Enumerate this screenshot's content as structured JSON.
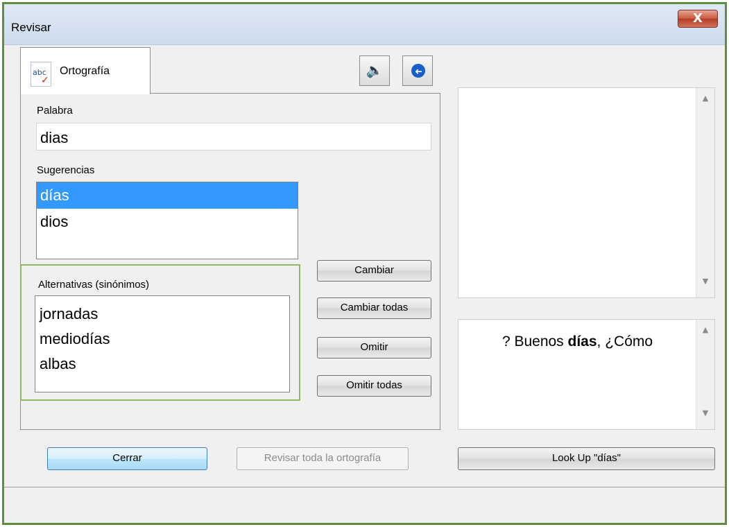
{
  "window": {
    "title": "Revisar",
    "close_label": "X"
  },
  "tab": {
    "icon_text": "abc",
    "icon_check": "✓",
    "label": "Ortografía"
  },
  "toolbar": {
    "speaker_glyph": "🔈",
    "back_glyph": "➜"
  },
  "word": {
    "label": "Palabra",
    "value": "dias"
  },
  "suggestions": {
    "label": "Sugerencias",
    "items": [
      "días",
      "dios"
    ]
  },
  "alternatives": {
    "label": "Alternativas (sinónimos)",
    "items": [
      "jornadas",
      "mediodías",
      "albas"
    ]
  },
  "buttons": {
    "change": "Cambiar",
    "change_all": "Cambiar todas",
    "ignore": "Omitir",
    "ignore_all": "Omitir todas",
    "close": "Cerrar",
    "check_all": "Revisar toda la ortografía",
    "lookup": "Look Up \"días\""
  },
  "context": {
    "prefix": "? Buenos ",
    "word": "días",
    "suffix": ", ¿Cómo"
  },
  "scroll": {
    "up": "▲",
    "down": "▼"
  }
}
